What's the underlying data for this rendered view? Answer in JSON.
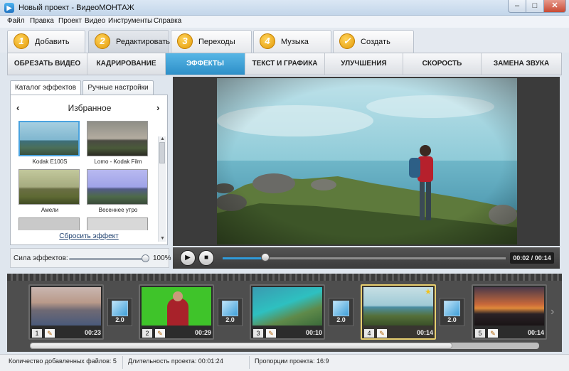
{
  "window": {
    "title": "Новый проект - ВидеоМОНТАЖ",
    "minimize": "–",
    "maximize": "□",
    "close": "✕"
  },
  "menu": [
    "Файл",
    "Правка",
    "Проект",
    "Видео",
    "Инструменты",
    "Справка"
  ],
  "steps": [
    {
      "num": "1",
      "label": "Добавить"
    },
    {
      "num": "2",
      "label": "Редактировать"
    },
    {
      "num": "3",
      "label": "Переходы"
    },
    {
      "num": "4",
      "label": "Музыка"
    },
    {
      "num": "✓",
      "label": "Создать"
    }
  ],
  "tabs": [
    "ОБРЕЗАТЬ ВИДЕО",
    "КАДРИРОВАНИЕ",
    "ЭФФЕКТЫ",
    "ТЕКСТ И ГРАФИКА",
    "УЛУЧШЕНИЯ",
    "СКОРОСТЬ",
    "ЗАМЕНА ЗВУКА"
  ],
  "effects_panel": {
    "subtabs": [
      "Каталог эффектов",
      "Ручные настройки"
    ],
    "category": "Избранное",
    "prev": "‹",
    "next": "›",
    "effects": [
      {
        "label": "Kodak E100S"
      },
      {
        "label": "Lomo - Kodak Film"
      },
      {
        "label": "Амели"
      },
      {
        "label": "Весеннее утро"
      },
      {
        "label": ""
      },
      {
        "label": ""
      }
    ],
    "reset": "Сбросить эффект"
  },
  "strength": {
    "label": "Сила эффектов:",
    "value": "100%",
    "level": 1.0
  },
  "player": {
    "play": "▶",
    "stop": "■",
    "time": "00:02 / 00:14",
    "progress": 0.15
  },
  "timeline": {
    "clips": [
      {
        "num": "1",
        "duration": "00:23",
        "edit": "✎"
      },
      {
        "num": "2",
        "duration": "00:29",
        "edit": "✎"
      },
      {
        "num": "3",
        "duration": "00:10",
        "edit": "✎"
      },
      {
        "num": "4",
        "duration": "00:14",
        "edit": "✎",
        "star": "★"
      },
      {
        "num": "5",
        "duration": "00:14",
        "edit": "✎"
      }
    ],
    "transitions": [
      {
        "duration": "2.0"
      },
      {
        "duration": "2.0"
      },
      {
        "duration": "2.0"
      },
      {
        "duration": "2.0"
      }
    ],
    "next_arrow": "›",
    "scroll_fraction": 0.83
  },
  "status": {
    "files": "Количество добавленных файлов: 5",
    "duration": "Длительность проекта: 00:01:24",
    "ratio": "Пропорции проекта: 16:9"
  }
}
